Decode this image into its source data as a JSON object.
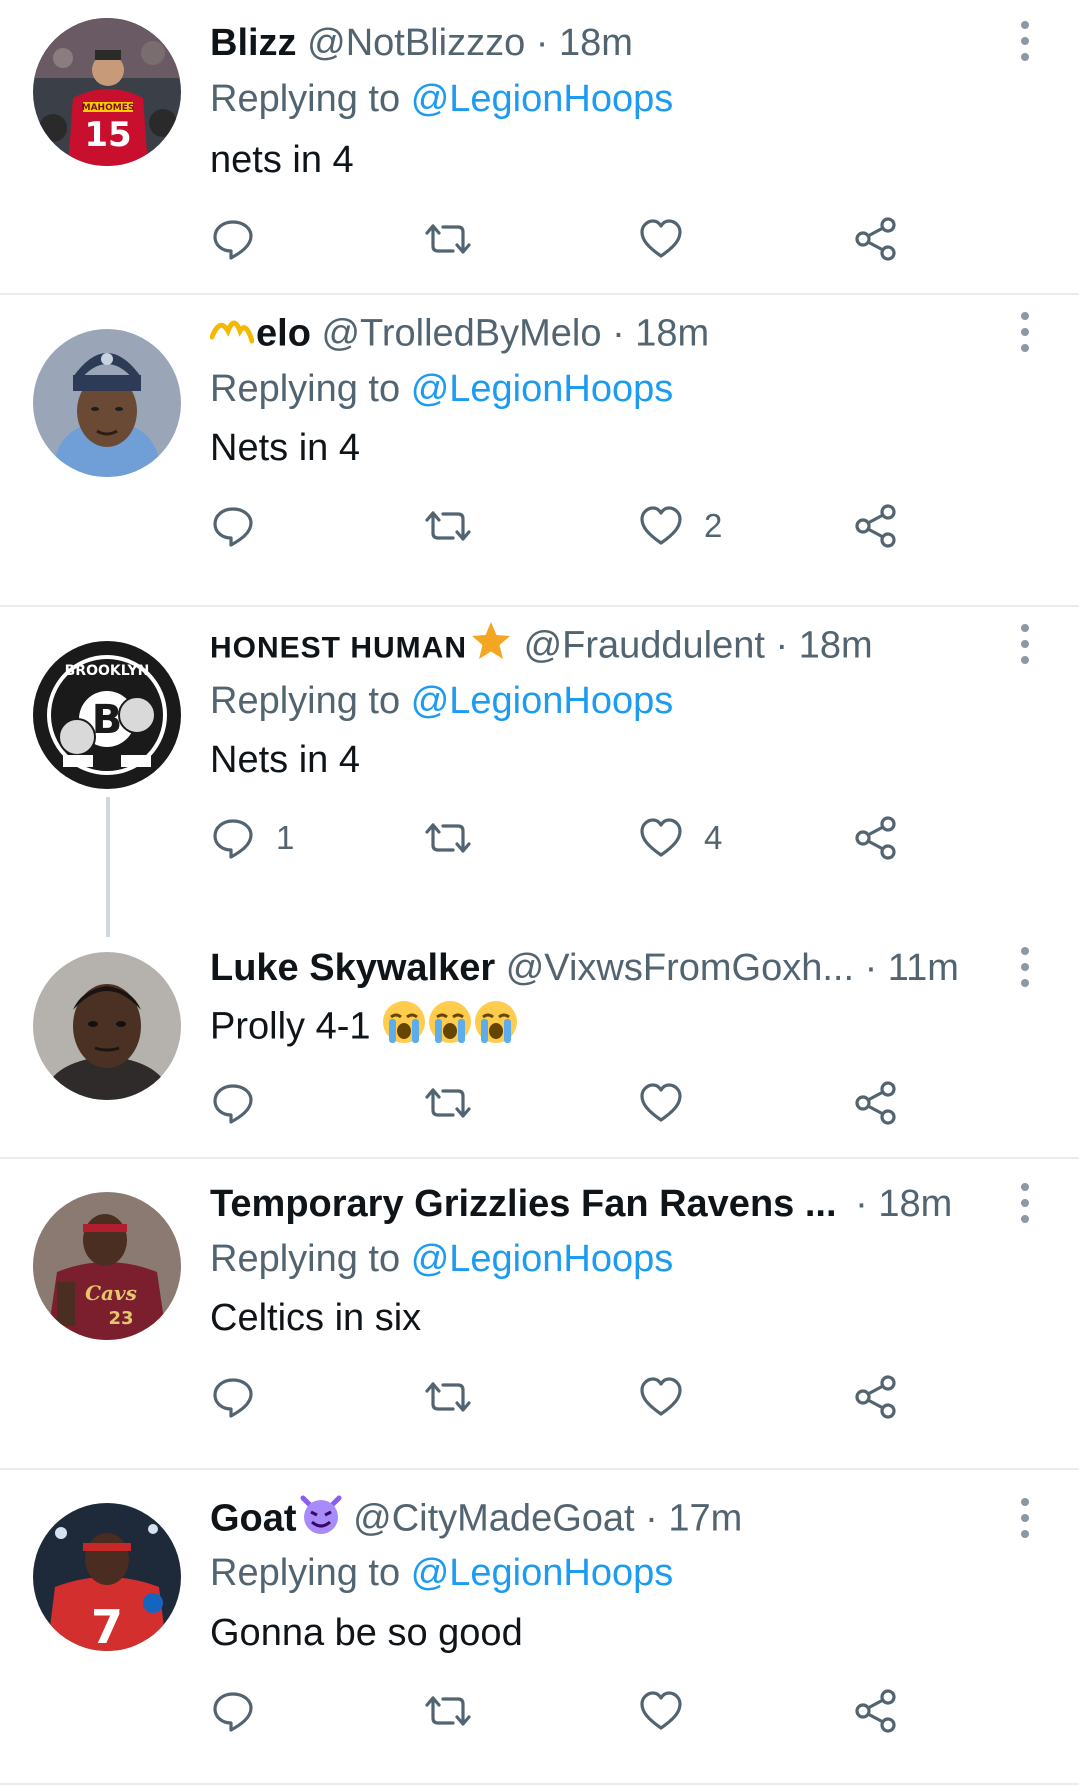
{
  "tweets": [
    {
      "name": "Blizz",
      "handle": "@NotBlizzzo",
      "separator": "·",
      "time": "18m",
      "replying_prefix": "Replying to",
      "replying_to": "@LegionHoops",
      "text": "nets in 4",
      "reply_count": "",
      "retweet_count": "",
      "like_count": "",
      "avatar_icon": "avatar-mahomes-photo"
    },
    {
      "name_prefix_icon": "melo-m-logo",
      "name": "elo",
      "handle": "@TrolledByMelo",
      "separator": "·",
      "time": "18m",
      "replying_prefix": "Replying to",
      "replying_to": "@LegionHoops",
      "text": "Nets in 4",
      "reply_count": "",
      "retweet_count": "",
      "like_count": "2",
      "avatar_icon": "avatar-melo-photo"
    },
    {
      "name": "HONEST HUMAN",
      "name_suffix_icon": "star-emoji",
      "handle": "@Frauddulent",
      "separator": "·",
      "time": "18m",
      "replying_prefix": "Replying to",
      "replying_to": "@LegionHoops",
      "text": "Nets in 4",
      "reply_count": "1",
      "retweet_count": "",
      "like_count": "4",
      "avatar_icon": "avatar-brooklyn-cartoon"
    },
    {
      "name": "Luke Skywalker",
      "handle": "@VixwsFromGoxh...",
      "separator": "·",
      "time": "11m",
      "text": "Prolly 4-1",
      "text_suffix_icons": [
        "loudly-crying-face-emoji",
        "loudly-crying-face-emoji",
        "loudly-crying-face-emoji"
      ],
      "reply_count": "",
      "retweet_count": "",
      "like_count": "",
      "avatar_icon": "avatar-portrait-photo"
    },
    {
      "name": "Temporary Grizzlies Fan Ravens ...",
      "separator": "·",
      "time": "18m",
      "replying_prefix": "Replying to",
      "replying_to": "@LegionHoops",
      "text": "Celtics in six",
      "reply_count": "",
      "retweet_count": "",
      "like_count": "",
      "avatar_icon": "avatar-cavaliers-photo"
    },
    {
      "name": "Goat",
      "name_suffix_icon": "smiling-imp-emoji",
      "handle": "@CityMadeGoat",
      "separator": "·",
      "time": "17m",
      "replying_prefix": "Replying to",
      "replying_to": "@LegionHoops",
      "text": "Gonna be so good",
      "reply_count": "",
      "retweet_count": "",
      "like_count": "",
      "avatar_icon": "avatar-football-photo"
    }
  ],
  "colors": {
    "text": "#0f1419",
    "secondary": "#536471",
    "link": "#1d9bf0",
    "divider": "#e6ecf0",
    "thread_line": "#cfd9de"
  }
}
